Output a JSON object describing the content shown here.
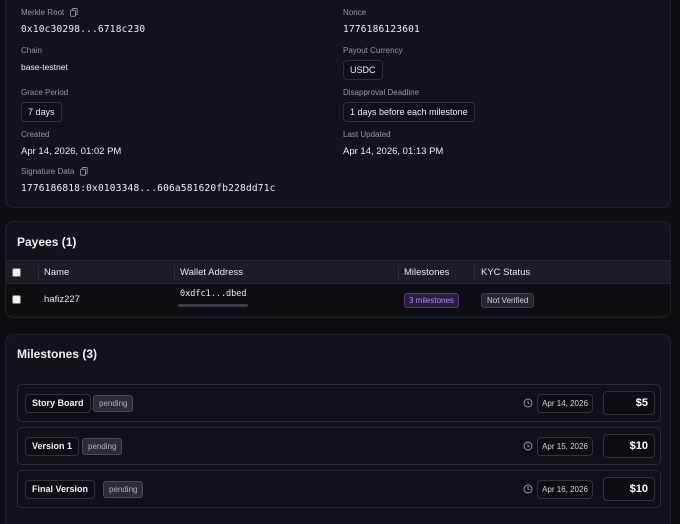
{
  "details": {
    "merkle_root_label": "Merkle Root",
    "merkle_root_value": "0x10c30298...6718c230",
    "nonce_label": "Nonce",
    "nonce_value": "1776186123601",
    "chain_label": "Chain",
    "chain_value": "base-testnet",
    "payout_currency_label": "Payout Currency",
    "payout_currency_value": "USDC",
    "grace_period_label": "Grace Period",
    "grace_period_value": "7 days",
    "disapproval_deadline_label": "Disapproval Deadline",
    "disapproval_deadline_value": "1 days before each milestone",
    "created_label": "Created",
    "created_value": "Apr 14, 2026, 01:02 PM",
    "last_updated_label": "Last Updated",
    "last_updated_value": "Apr 14, 2026, 01:13 PM",
    "signature_label": "Signature Data",
    "signature_value": "1776186818:0x0103348...606a581620fb228dd71c"
  },
  "payees": {
    "title": "Payees (1)",
    "columns": [
      "Name",
      "Wallet Address",
      "Milestones",
      "KYC Status"
    ],
    "rows": [
      {
        "name": "hafiz227",
        "wallet": "0xdfc1...dbed",
        "milestones": "3 milestones",
        "kyc": "Not Verified"
      }
    ]
  },
  "milestones": {
    "title": "Milestones (3)",
    "items": [
      {
        "name": "Story Board",
        "status": "pending",
        "date": "Apr 14, 2026",
        "amount": "$5"
      },
      {
        "name": "Version 1",
        "status": "pending",
        "date": "Apr 15, 2026",
        "amount": "$10"
      },
      {
        "name": "Final Version",
        "status": "pending",
        "date": "Apr 16, 2026",
        "amount": "$10"
      }
    ]
  },
  "icons": {
    "copy": "copy-icon",
    "clock": "clock-icon"
  },
  "colors": {
    "background": "#0b0d12",
    "card": "#10131a",
    "milestone_badge_text": "#b18af0",
    "milestone_badge_bg": "#2a1c3f"
  }
}
